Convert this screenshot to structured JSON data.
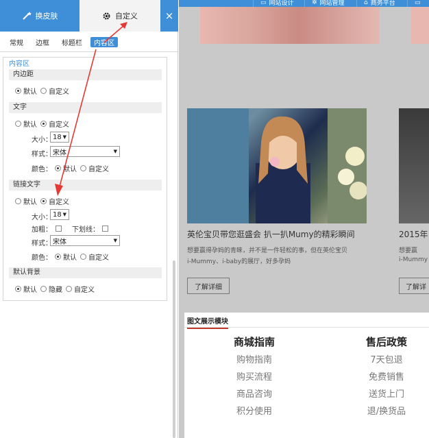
{
  "panel": {
    "tabs": {
      "skin": "换皮肤",
      "custom": "自定义",
      "close": "×"
    },
    "subtabs": [
      "常规",
      "边框",
      "标题栏",
      "内容区"
    ],
    "content_title": "内容区",
    "padding": {
      "title": "内边距",
      "opt_default": "默认",
      "opt_custom": "自定义"
    },
    "text": {
      "title": "文字",
      "opt_default": "默认",
      "opt_custom": "自定义",
      "size_label": "大小：",
      "size_value": "18",
      "style_label": "样式：",
      "style_value": "宋体",
      "color_label": "颜色：",
      "color_default": "默认",
      "color_custom": "自定义"
    },
    "link": {
      "title": "链接文字",
      "opt_default": "默认",
      "opt_custom": "自定义",
      "size_label": "大小：",
      "size_value": "18",
      "bold_label": "加粗：",
      "underline_label": "下划线：",
      "style_label": "样式：",
      "style_value": "宋体",
      "color_label": "颜色：",
      "color_default": "默认",
      "color_custom": "自定义"
    },
    "bg": {
      "title": "默认背景",
      "opt_default": "默认",
      "opt_hidden": "隐藏",
      "opt_custom": "自定义"
    }
  },
  "topnav": [
    "网站设计",
    "网站管理",
    "商务平台"
  ],
  "card": {
    "title": "英伦宝贝带您逛盛会 扒一扒Mumy的精彩瞬间",
    "desc1": "想要赢得孕妈的青睐，并不是一件轻松的事，但在英伦宝贝",
    "desc2": "i-Mummy、i-baby的展厅，好多孕妈",
    "more": "了解详细",
    "title2": "2015年",
    "desc3": "想要赢",
    "desc4": "i-Mummy",
    "more2": "了解详"
  },
  "module": {
    "title": "图文展示模块",
    "col1": {
      "head": "商城指南",
      "items": [
        "购物指南",
        "购买流程",
        "商品咨询",
        "积分使用"
      ]
    },
    "col2": {
      "head": "售后政策",
      "items": [
        "7天包退",
        "免费销售",
        "送货上门",
        "退/换货品"
      ]
    }
  },
  "colors": {
    "accent": "#3e8fd8",
    "arrow": "#e53935"
  }
}
